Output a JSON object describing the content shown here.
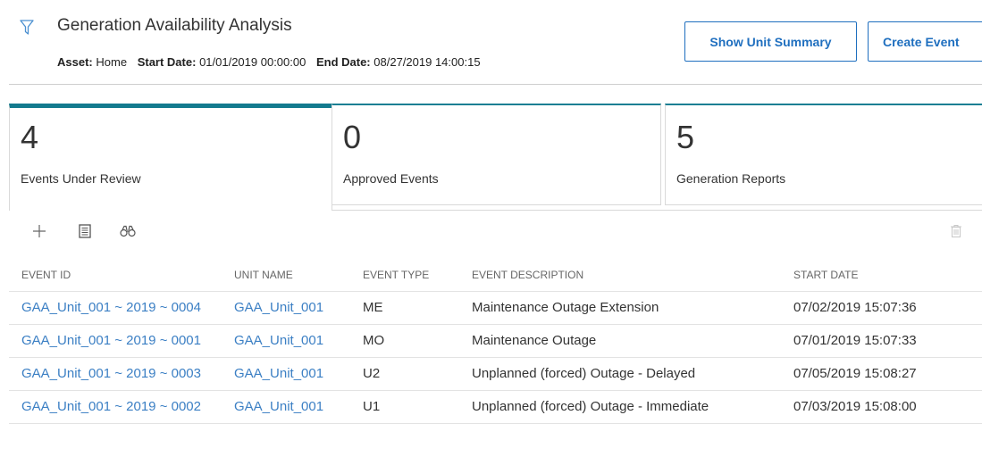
{
  "header": {
    "title": "Generation Availability Analysis",
    "asset_label": "Asset:",
    "asset_value": "Home",
    "start_label": "Start Date:",
    "start_value": "01/01/2019 00:00:00",
    "end_label": "End Date:",
    "end_value": "08/27/2019 14:00:15",
    "show_unit_summary": "Show Unit Summary",
    "create_event": "Create Event"
  },
  "tiles": [
    {
      "count": "4",
      "label": "Events Under Review",
      "active": true
    },
    {
      "count": "0",
      "label": "Approved Events",
      "active": false
    },
    {
      "count": "5",
      "label": "Generation Reports",
      "active": false
    }
  ],
  "toolbar": {
    "icons": [
      "plus-icon",
      "document-icon",
      "binoculars-icon",
      "trash-icon"
    ]
  },
  "table": {
    "columns": [
      "EVENT ID",
      "UNIT NAME",
      "EVENT TYPE",
      "EVENT DESCRIPTION",
      "START DATE"
    ],
    "rows": [
      {
        "event_id": "GAA_Unit_001 ~ 2019 ~ 0004",
        "unit_name": "GAA_Unit_001",
        "event_type": "ME",
        "description": "Maintenance Outage Extension",
        "start_date": "07/02/2019 15:07:36"
      },
      {
        "event_id": "GAA_Unit_001 ~ 2019 ~ 0001",
        "unit_name": "GAA_Unit_001",
        "event_type": "MO",
        "description": "Maintenance Outage",
        "start_date": "07/01/2019 15:07:33"
      },
      {
        "event_id": "GAA_Unit_001 ~ 2019 ~ 0003",
        "unit_name": "GAA_Unit_001",
        "event_type": "U2",
        "description": "Unplanned (forced) Outage - Delayed",
        "start_date": "07/05/2019 15:08:27"
      },
      {
        "event_id": "GAA_Unit_001 ~ 2019 ~ 0002",
        "unit_name": "GAA_Unit_001",
        "event_type": "U1",
        "description": "Unplanned (forced) Outage - Immediate",
        "start_date": "07/03/2019 15:08:00"
      }
    ]
  },
  "colors": {
    "accent": "#137a8e",
    "link": "#3b7fc4",
    "button": "#1f6fbf"
  }
}
